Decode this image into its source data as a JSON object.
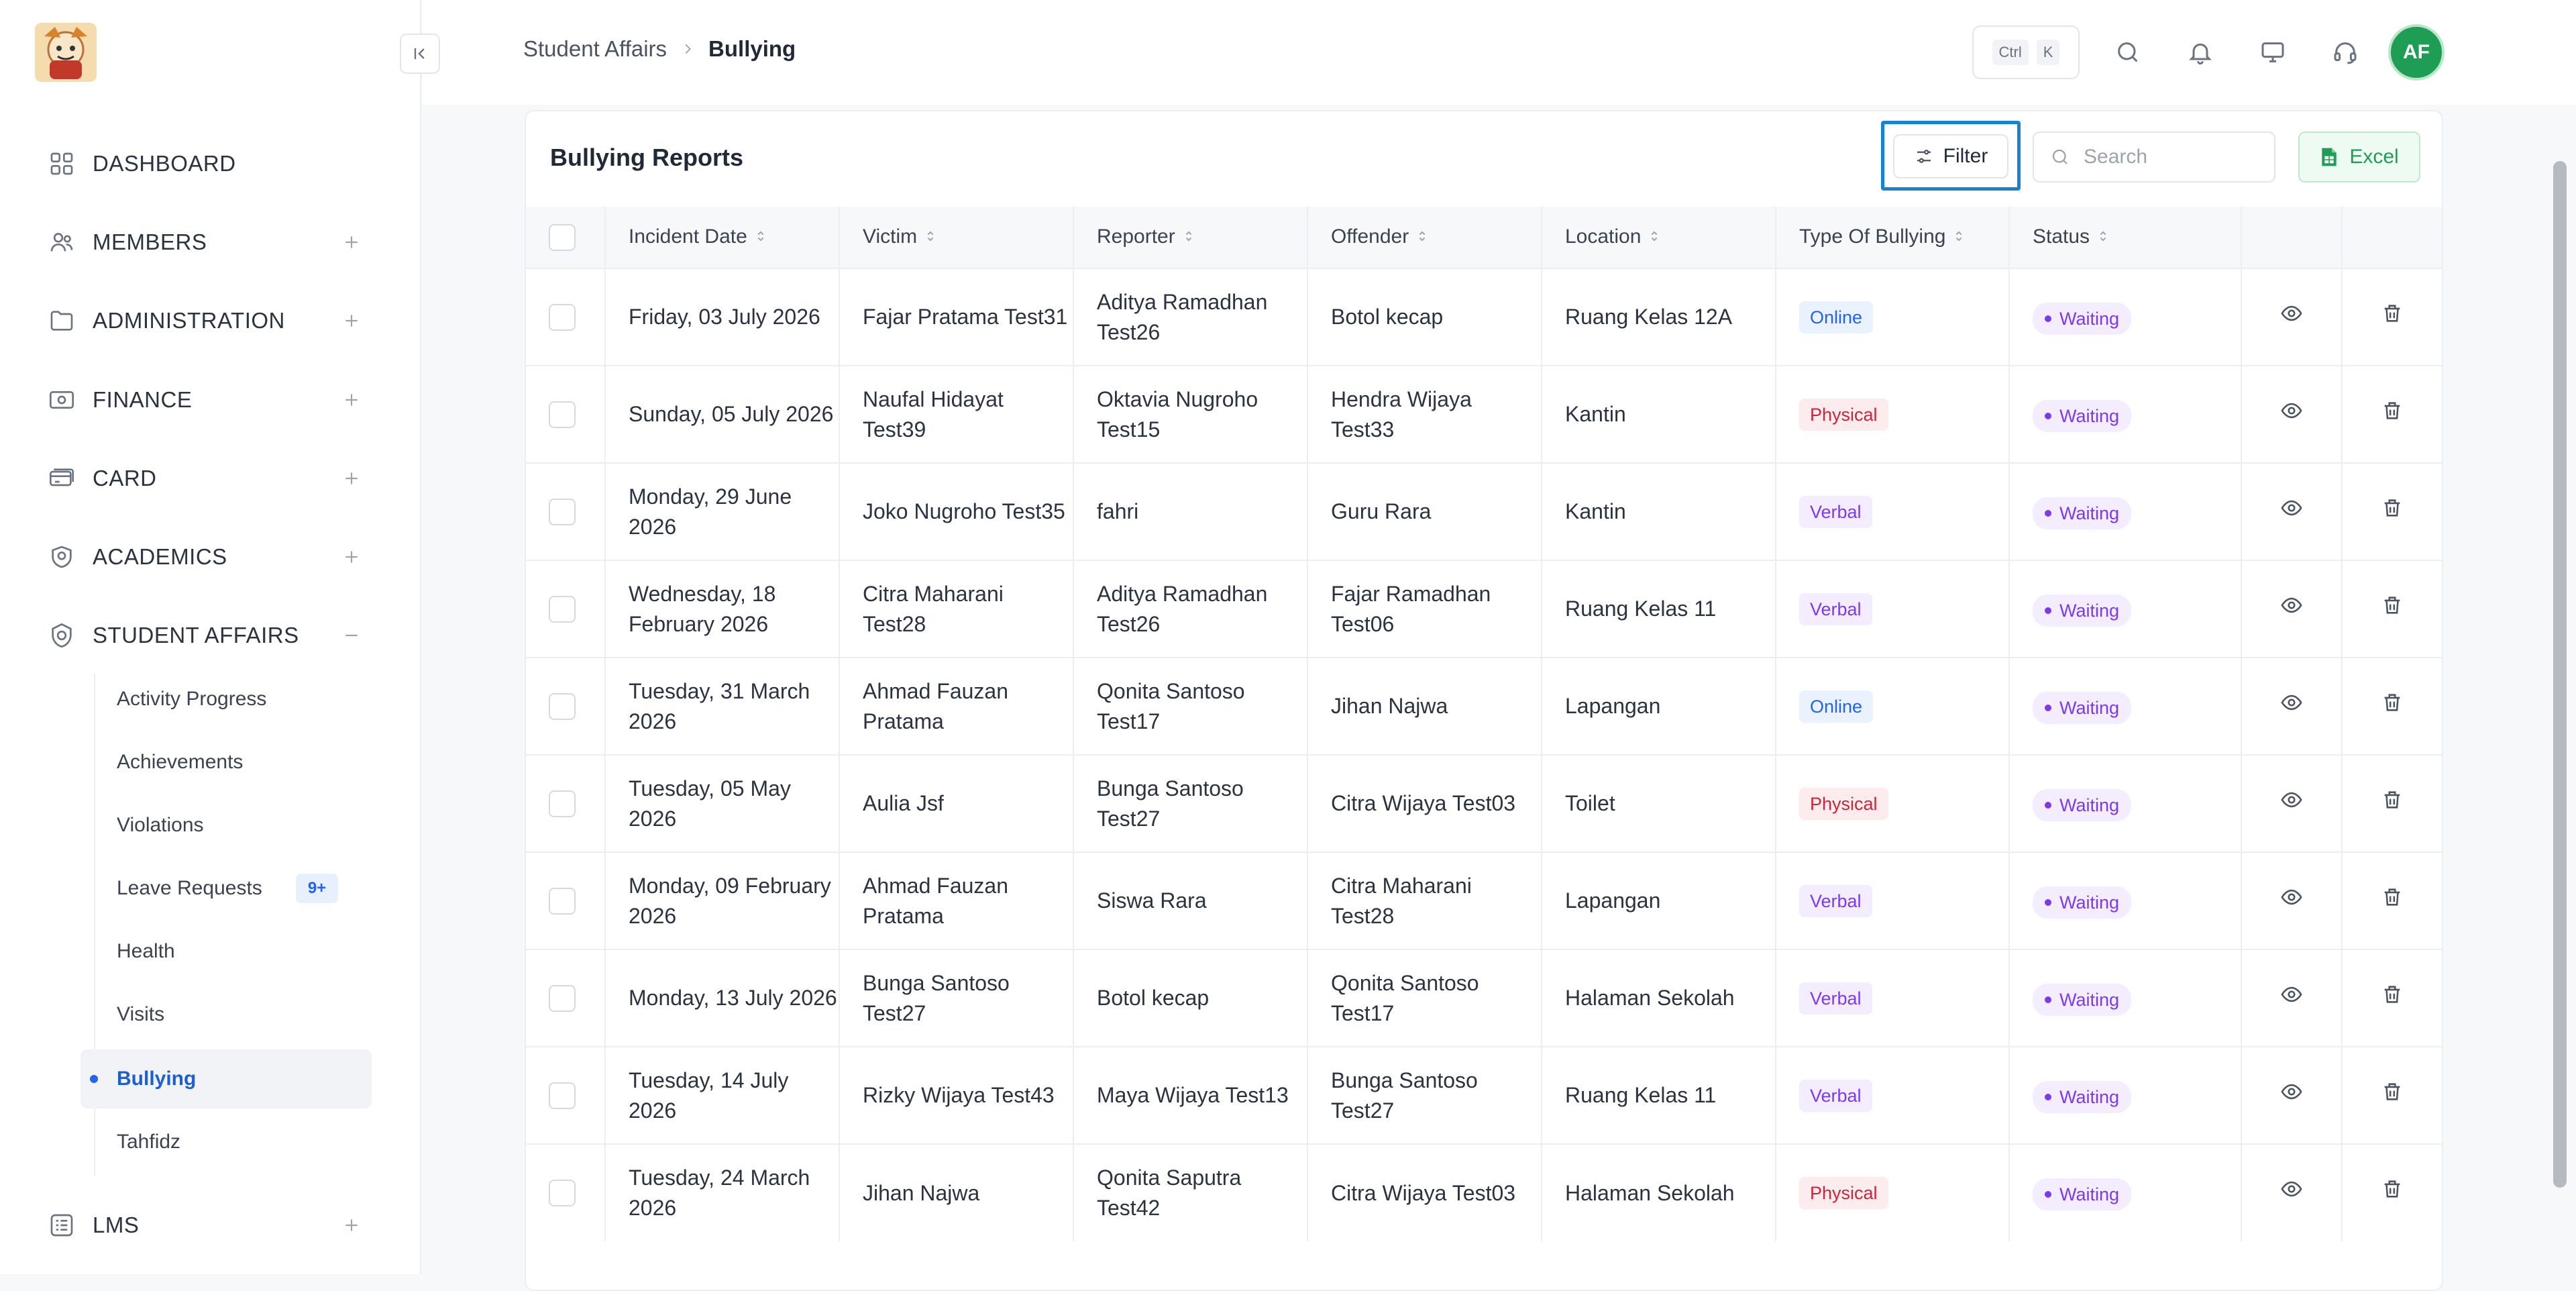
{
  "sidebar": {
    "logo_alt": "",
    "items": [
      {
        "label": "DASHBOARD",
        "icon": "dashboard-grid-icon",
        "expandable": false
      },
      {
        "label": "MEMBERS",
        "icon": "users-icon",
        "expandable": true
      },
      {
        "label": "ADMINISTRATION",
        "icon": "folder-icon",
        "expandable": true
      },
      {
        "label": "FINANCE",
        "icon": "money-icon",
        "expandable": true
      },
      {
        "label": "CARD",
        "icon": "card-icon",
        "expandable": true
      },
      {
        "label": "ACADEMICS",
        "icon": "academics-icon",
        "expandable": true
      },
      {
        "label": "STUDENT AFFAIRS",
        "icon": "student-affairs-icon",
        "expandable": true,
        "expanded": true
      },
      {
        "label": "LMS",
        "icon": "lms-icon",
        "expandable": true
      }
    ],
    "sub_items": [
      {
        "label": "Activity Progress"
      },
      {
        "label": "Achievements"
      },
      {
        "label": "Violations"
      },
      {
        "label": "Leave Requests",
        "badge": "9+"
      },
      {
        "label": "Health"
      },
      {
        "label": "Visits"
      },
      {
        "label": "Bullying",
        "active": true
      },
      {
        "label": "Tahfidz"
      }
    ]
  },
  "topbar": {
    "breadcrumb": [
      "Student Affairs",
      "Bullying"
    ],
    "shortcut_keys": [
      "Ctrl",
      "K"
    ],
    "icons": [
      "search-icon",
      "bell-icon",
      "monitor-icon",
      "headset-icon"
    ],
    "avatar_initials": "AF"
  },
  "card": {
    "title": "Bullying Reports",
    "filter_label": "Filter",
    "search_placeholder": "Search",
    "excel_label": "Excel",
    "columns": [
      "Incident Date",
      "Victim",
      "Reporter",
      "Offender",
      "Location",
      "Type Of Bullying",
      "Status"
    ],
    "rows": [
      {
        "date": "Friday, 03 July 2026",
        "victim": "Fajar Pratama Test31",
        "reporter": "Aditya Ramadhan Test26",
        "offender": "Botol kecap",
        "location": "Ruang Kelas 12A",
        "type": "Online",
        "status": "Waiting"
      },
      {
        "date": "Sunday, 05 July 2026",
        "victim": "Naufal Hidayat Test39",
        "reporter": "Oktavia Nugroho Test15",
        "offender": "Hendra Wijaya Test33",
        "location": "Kantin",
        "type": "Physical",
        "status": "Waiting"
      },
      {
        "date": "Monday, 29 June 2026",
        "victim": "Joko Nugroho Test35",
        "reporter": "fahri",
        "offender": "Guru Rara",
        "location": "Kantin",
        "type": "Verbal",
        "status": "Waiting"
      },
      {
        "date": "Wednesday, 18 February 2026",
        "victim": "Citra Maharani Test28",
        "reporter": "Aditya Ramadhan Test26",
        "offender": "Fajar Ramadhan Test06",
        "location": "Ruang Kelas 11",
        "type": "Verbal",
        "status": "Waiting"
      },
      {
        "date": "Tuesday, 31 March 2026",
        "victim": "Ahmad Fauzan Pratama",
        "reporter": "Qonita Santoso Test17",
        "offender": "Jihan Najwa",
        "location": "Lapangan",
        "type": "Online",
        "status": "Waiting"
      },
      {
        "date": "Tuesday, 05 May 2026",
        "victim": "Aulia Jsf",
        "reporter": "Bunga Santoso Test27",
        "offender": "Citra Wijaya Test03",
        "location": "Toilet",
        "type": "Physical",
        "status": "Waiting"
      },
      {
        "date": "Monday, 09 February 2026",
        "victim": "Ahmad Fauzan Pratama",
        "reporter": "Siswa Rara",
        "offender": "Citra Maharani Test28",
        "location": "Lapangan",
        "type": "Verbal",
        "status": "Waiting"
      },
      {
        "date": "Monday, 13 July 2026",
        "victim": "Bunga Santoso Test27",
        "reporter": "Botol kecap",
        "offender": "Qonita Santoso Test17",
        "location": "Halaman Sekolah",
        "type": "Verbal",
        "status": "Waiting"
      },
      {
        "date": "Tuesday, 14 July 2026",
        "victim": "Rizky Wijaya Test43",
        "reporter": "Maya Wijaya Test13",
        "offender": "Bunga Santoso Test27",
        "location": "Ruang Kelas 11",
        "type": "Verbal",
        "status": "Waiting"
      },
      {
        "date": "Tuesday, 24 March 2026",
        "victim": "Jihan Najwa",
        "reporter": "Qonita Saputra Test42",
        "offender": "Citra Wijaya Test03",
        "location": "Halaman Sekolah",
        "type": "Physical",
        "status": "Waiting"
      }
    ]
  },
  "colors": {
    "accent": "#2563eb",
    "highlight_border": "#1583d1",
    "excel_green": "#1f9d55",
    "status_purple": "#7c3aed",
    "physical_red": "#c5283d"
  }
}
